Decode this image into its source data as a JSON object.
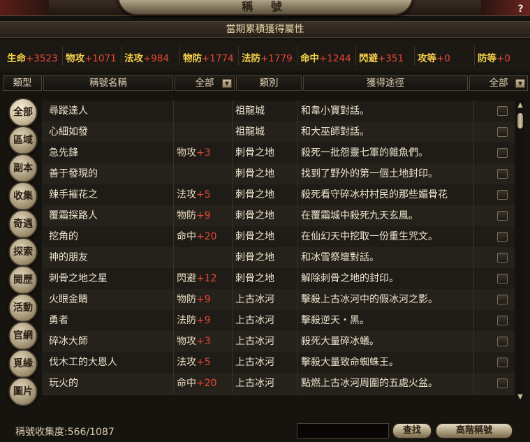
{
  "window": {
    "title": "稱 號",
    "help_label": "?"
  },
  "section_title": "當期累積獲得屬性",
  "stats": [
    {
      "label": "生命",
      "value": "+3523"
    },
    {
      "label": "物攻",
      "value": "+1071"
    },
    {
      "label": "法攻",
      "value": "+984"
    },
    {
      "label": "物防",
      "value": "+1774"
    },
    {
      "label": "法防",
      "value": "+1779"
    },
    {
      "label": "命中",
      "value": "+1244"
    },
    {
      "label": "閃避",
      "value": "+351"
    },
    {
      "label": "攻等",
      "value": "+0"
    },
    {
      "label": "防等",
      "value": "+0"
    }
  ],
  "columns": {
    "type": "類型",
    "name": "稱號名稱",
    "bonus_filter": "全部",
    "category": "類別",
    "source": "獲得途徑",
    "source_filter": "全部"
  },
  "tabs": [
    "全部",
    "區域",
    "副本",
    "收集",
    "奇遇",
    "探索",
    "閱歷",
    "活動",
    "官網",
    "覓緣",
    "圖片"
  ],
  "active_tab": 0,
  "rows": [
    {
      "name": "尋蹤達人",
      "bonus_label": "",
      "bonus_value": "",
      "category": "祖龍城",
      "source": "和韋小寶對話。"
    },
    {
      "name": "心細如發",
      "bonus_label": "",
      "bonus_value": "",
      "category": "祖龍城",
      "source": "和大巫師對話。"
    },
    {
      "name": "急先鋒",
      "bonus_label": "物攻",
      "bonus_value": "+3",
      "category": "刺骨之地",
      "source": "殺死一批怨靈七軍的雜魚們。"
    },
    {
      "name": "善于發現的",
      "bonus_label": "",
      "bonus_value": "",
      "category": "刺骨之地",
      "source": "找到了野外的第一個土地封印。"
    },
    {
      "name": "辣手摧花之",
      "bonus_label": "法攻",
      "bonus_value": "+5",
      "category": "刺骨之地",
      "source": "殺死看守碎冰村村民的那些媚骨花"
    },
    {
      "name": "覆霜探路人",
      "bonus_label": "物防",
      "bonus_value": "+9",
      "category": "刺骨之地",
      "source": "在覆霜城中殺死九天玄鳳。"
    },
    {
      "name": "挖角的",
      "bonus_label": "命中",
      "bonus_value": "+20",
      "category": "刺骨之地",
      "source": "在仙幻天中挖取一份重生咒文。"
    },
    {
      "name": "神的朋友",
      "bonus_label": "",
      "bonus_value": "",
      "category": "刺骨之地",
      "source": "和冰雪祭壇對話。"
    },
    {
      "name": "刺骨之地之星",
      "bonus_label": "閃避",
      "bonus_value": "+12",
      "category": "刺骨之地",
      "source": "解除刺骨之地的封印。"
    },
    {
      "name": "火眼金睛",
      "bonus_label": "物防",
      "bonus_value": "+9",
      "category": "上古冰河",
      "source": "擊殺上古冰河中的假冰河之影。"
    },
    {
      "name": "勇者",
      "bonus_label": "法防",
      "bonus_value": "+9",
      "category": "上古冰河",
      "source": "擊殺逆天・黑。"
    },
    {
      "name": "碎冰大師",
      "bonus_label": "物攻",
      "bonus_value": "+3",
      "category": "上古冰河",
      "source": "殺死大量碎冰蟻。"
    },
    {
      "name": "伐木工的大恩人",
      "bonus_label": "法攻",
      "bonus_value": "+5",
      "category": "上古冰河",
      "source": "擊殺大量致命蜘蛛王。"
    },
    {
      "name": "玩火的",
      "bonus_label": "命中",
      "bonus_value": "+20",
      "category": "上古冰河",
      "source": "點燃上古冰河周圍的五處火盆。"
    }
  ],
  "footer": {
    "collection_text": "稱號收集度:566/1087",
    "search_value": "",
    "search_button": "查找",
    "advanced_button": "高階稱號"
  }
}
